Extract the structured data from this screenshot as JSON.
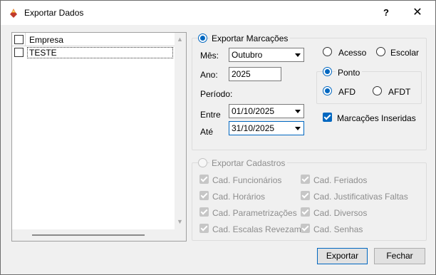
{
  "window": {
    "title": "Exportar Dados",
    "help_label": "?",
    "close_label": "✕"
  },
  "company_list": {
    "header": "Empresa",
    "items": [
      {
        "label": "TESTE",
        "checked": false
      }
    ]
  },
  "marcacoes": {
    "title": "Exportar Marcações",
    "selected": true,
    "mes_label": "Mês:",
    "mes_value": "Outubro",
    "ano_label": "Ano:",
    "ano_value": "2025",
    "periodo_label": "Período:",
    "entre_label": "Entre",
    "entre_value": "01/10/2025",
    "ate_label": "Até",
    "ate_value": "31/10/2025",
    "acesso_label": "Acesso",
    "escolar_label": "Escolar",
    "ponto": {
      "title": "Ponto",
      "afd_label": "AFD",
      "afdt_label": "AFDT"
    },
    "inseridas_label": "Marcações Inseridas"
  },
  "cadastros": {
    "title": "Exportar Cadastros",
    "items": [
      "Cad. Funcionários",
      "Cad. Horários",
      "Cad. Parametrizações",
      "Cad. Escalas Revezam.",
      "Cad. Feriados",
      "Cad. Justificativas Faltas",
      "Cad. Diversos",
      "Cad. Senhas"
    ]
  },
  "buttons": {
    "export": "Exportar",
    "close": "Fechar"
  },
  "colors": {
    "accent": "#0067c0",
    "disabled": "#8d8d8d"
  }
}
